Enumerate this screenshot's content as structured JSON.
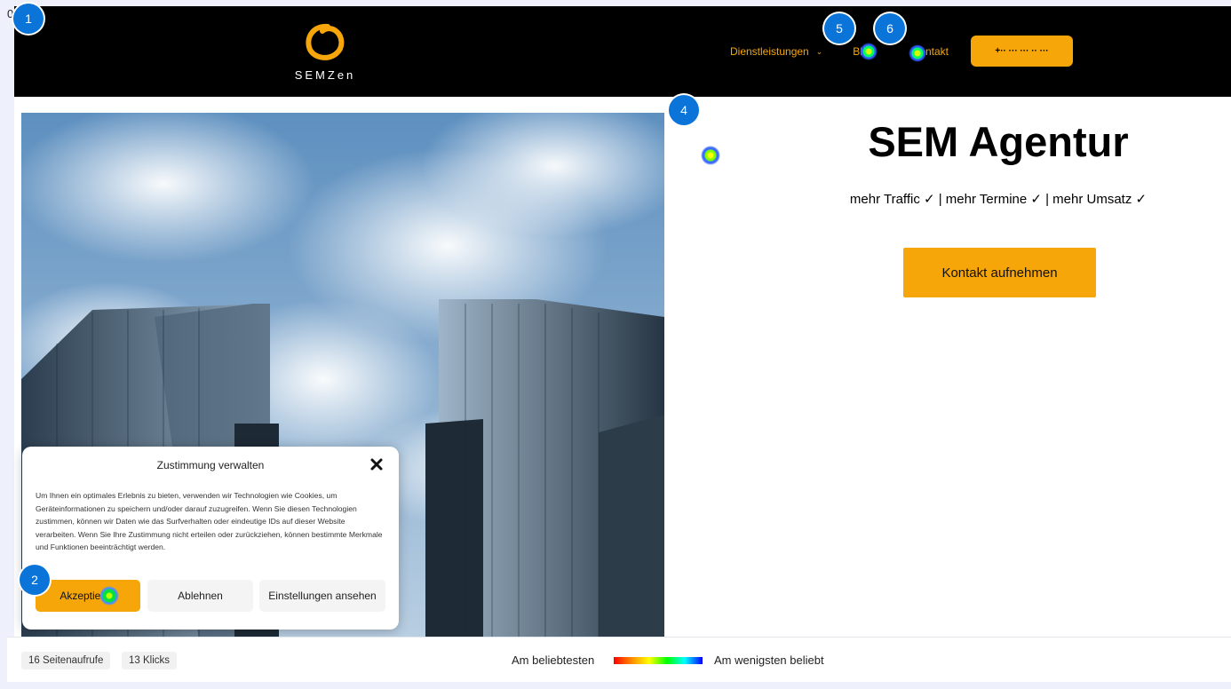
{
  "overlay": {
    "origin_label": "0",
    "markers": [
      "1",
      "2",
      "4",
      "5",
      "6"
    ]
  },
  "header": {
    "logo_text": "SEMZen",
    "nav": {
      "services": "Dienstleistungen",
      "blog": "Blog",
      "contact": "Kontakt"
    },
    "phone_button": "+·· ··· ··· ·· ···"
  },
  "hero": {
    "title": "SEM Agentur",
    "subtitle": "mehr Traffic ✓ | mehr Termine ✓ | mehr Umsatz ✓",
    "cta": "Kontakt aufnehmen"
  },
  "cookie": {
    "title": "Zustimmung verwalten",
    "text": "Um Ihnen ein optimales Erlebnis zu bieten, verwenden wir Technologien wie Cookies, um Geräteinformationen zu speichern und/oder darauf zuzugreifen. Wenn Sie diesen Technologien zustimmen, können wir Daten wie das Surfverhalten oder eindeutige IDs auf dieser Website verarbeiten. Wenn Sie Ihre Zustimmung nicht erteilen oder zurückziehen, können bestimmte Merkmale und Funktionen beeinträchtigt werden.",
    "accept": "Akzeptieren",
    "decline": "Ablehnen",
    "settings": "Einstellungen ansehen"
  },
  "stats": {
    "page_views": "16 Seitenaufrufe",
    "clicks": "13 Klicks"
  },
  "legend": {
    "most": "Am beliebtesten",
    "least": "Am wenigsten beliebt"
  },
  "colors": {
    "brand_orange": "#f6a609",
    "header_bg": "#000000",
    "marker_blue": "#0a74d8"
  }
}
